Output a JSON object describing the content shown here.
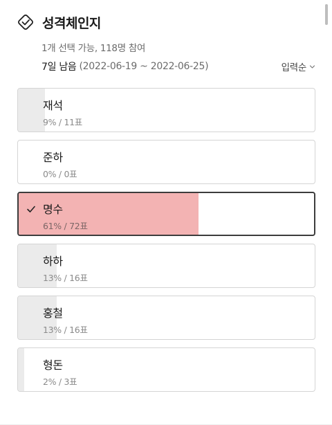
{
  "poll": {
    "title": "성격체인지",
    "meta": "1개 선택 가능, 118명 참여",
    "deadline_remaining": "7일 남음",
    "deadline_range": "(2022-06-19 ~ 2022-06-25)",
    "sort_label": "입력순"
  },
  "options": [
    {
      "name": "재석",
      "stat": "9% / 11표",
      "percent": 9,
      "selected": false
    },
    {
      "name": "준하",
      "stat": "0% / 0표",
      "percent": 0,
      "selected": false
    },
    {
      "name": "명수",
      "stat": "61% / 72표",
      "percent": 61,
      "selected": true
    },
    {
      "name": "하하",
      "stat": "13% / 16표",
      "percent": 13,
      "selected": false
    },
    {
      "name": "홍철",
      "stat": "13% / 16표",
      "percent": 13,
      "selected": false
    },
    {
      "name": "형돈",
      "stat": "2% / 3표",
      "percent": 2,
      "selected": false
    }
  ],
  "icons": {
    "title_icon": "vote-check-icon",
    "selected_icon": "check-icon",
    "sort_icon": "chevron-down-icon"
  },
  "colors": {
    "selected_fill": "#f3b3b3",
    "unselected_fill": "#ebebeb",
    "selected_border": "#3c3c3c"
  }
}
